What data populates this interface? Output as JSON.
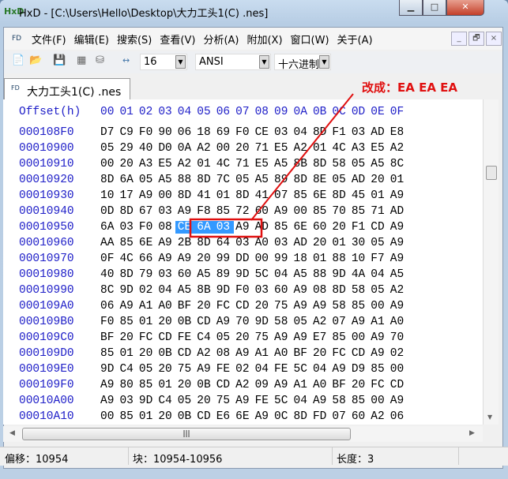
{
  "window": {
    "title": "HxD - [C:\\Users\\Hello\\Desktop\\大力工头1(C) .nes]",
    "app_icon": "HxD"
  },
  "menu": [
    "文件(F)",
    "编辑(E)",
    "搜索(S)",
    "查看(V)",
    "分析(A)",
    "附加(X)",
    "窗口(W)",
    "关于(A)"
  ],
  "toolbar": {
    "bytes_per_row": "16",
    "charset": "ANSI",
    "display": "十六进制"
  },
  "tab": {
    "label": "大力工头1(C) .nes"
  },
  "annotation": {
    "text": "改成：EA  EA  EA",
    "color": "#e01010"
  },
  "hex": {
    "header_offset": "Offset(h)",
    "header_cols": [
      "00",
      "01",
      "02",
      "03",
      "04",
      "05",
      "06",
      "07",
      "08",
      "09",
      "0A",
      "0B",
      "0C",
      "0D",
      "0E",
      "0F"
    ],
    "selected": {
      "row": "00010950",
      "start": 4,
      "end": 6
    },
    "rows": [
      {
        "offset": "000108F0",
        "bytes": [
          "D7",
          "C9",
          "F0",
          "90",
          "06",
          "18",
          "69",
          "F0",
          "CE",
          "03",
          "04",
          "8D",
          "F1",
          "03",
          "AD",
          "E8"
        ]
      },
      {
        "offset": "00010900",
        "bytes": [
          "05",
          "29",
          "40",
          "D0",
          "0A",
          "A2",
          "00",
          "20",
          "71",
          "E5",
          "A2",
          "01",
          "4C",
          "A3",
          "E5",
          "A2"
        ]
      },
      {
        "offset": "00010910",
        "bytes": [
          "00",
          "20",
          "A3",
          "E5",
          "A2",
          "01",
          "4C",
          "71",
          "E5",
          "A5",
          "8B",
          "8D",
          "58",
          "05",
          "A5",
          "8C"
        ]
      },
      {
        "offset": "00010920",
        "bytes": [
          "8D",
          "6A",
          "05",
          "A5",
          "88",
          "8D",
          "7C",
          "05",
          "A5",
          "89",
          "8D",
          "8E",
          "05",
          "AD",
          "20",
          "01"
        ]
      },
      {
        "offset": "00010930",
        "bytes": [
          "10",
          "17",
          "A9",
          "00",
          "8D",
          "41",
          "01",
          "8D",
          "41",
          "07",
          "85",
          "6E",
          "8D",
          "45",
          "01",
          "A9"
        ]
      },
      {
        "offset": "00010940",
        "bytes": [
          "0D",
          "8D",
          "67",
          "03",
          "A9",
          "F8",
          "85",
          "72",
          "60",
          "A9",
          "00",
          "85",
          "70",
          "85",
          "71",
          "AD"
        ]
      },
      {
        "offset": "00010950",
        "bytes": [
          "6A",
          "03",
          "F0",
          "08",
          "CE",
          "6A",
          "03",
          "A9",
          "AD",
          "85",
          "6E",
          "60",
          "20",
          "F1",
          "CD",
          "A9"
        ]
      },
      {
        "offset": "00010960",
        "bytes": [
          "AA",
          "85",
          "6E",
          "A9",
          "2B",
          "8D",
          "64",
          "03",
          "A0",
          "03",
          "AD",
          "20",
          "01",
          "30",
          "05",
          "A9"
        ]
      },
      {
        "offset": "00010970",
        "bytes": [
          "0F",
          "4C",
          "66",
          "A9",
          "A9",
          "20",
          "99",
          "DD",
          "00",
          "99",
          "18",
          "01",
          "88",
          "10",
          "F7",
          "A9"
        ]
      },
      {
        "offset": "00010980",
        "bytes": [
          "40",
          "8D",
          "79",
          "03",
          "60",
          "A5",
          "89",
          "9D",
          "5C",
          "04",
          "A5",
          "88",
          "9D",
          "4A",
          "04",
          "A5"
        ]
      },
      {
        "offset": "00010990",
        "bytes": [
          "8C",
          "9D",
          "02",
          "04",
          "A5",
          "8B",
          "9D",
          "F0",
          "03",
          "60",
          "A9",
          "08",
          "8D",
          "58",
          "05",
          "A2"
        ]
      },
      {
        "offset": "000109A0",
        "bytes": [
          "06",
          "A9",
          "A1",
          "A0",
          "BF",
          "20",
          "FC",
          "CD",
          "20",
          "75",
          "A9",
          "A9",
          "58",
          "85",
          "00",
          "A9"
        ]
      },
      {
        "offset": "000109B0",
        "bytes": [
          "F0",
          "85",
          "01",
          "20",
          "0B",
          "CD",
          "A9",
          "70",
          "9D",
          "58",
          "05",
          "A2",
          "07",
          "A9",
          "A1",
          "A0"
        ]
      },
      {
        "offset": "000109C0",
        "bytes": [
          "BF",
          "20",
          "FC",
          "CD",
          "FE",
          "C4",
          "05",
          "20",
          "75",
          "A9",
          "A9",
          "E7",
          "85",
          "00",
          "A9",
          "70"
        ]
      },
      {
        "offset": "000109D0",
        "bytes": [
          "85",
          "01",
          "20",
          "0B",
          "CD",
          "A2",
          "08",
          "A9",
          "A1",
          "A0",
          "BF",
          "20",
          "FC",
          "CD",
          "A9",
          "02"
        ]
      },
      {
        "offset": "000109E0",
        "bytes": [
          "9D",
          "C4",
          "05",
          "20",
          "75",
          "A9",
          "FE",
          "02",
          "04",
          "FE",
          "5C",
          "04",
          "A9",
          "D9",
          "85",
          "00"
        ]
      },
      {
        "offset": "000109F0",
        "bytes": [
          "A9",
          "80",
          "85",
          "01",
          "20",
          "0B",
          "CD",
          "A2",
          "09",
          "A9",
          "A1",
          "A0",
          "BF",
          "20",
          "FC",
          "CD"
        ]
      },
      {
        "offset": "00010A00",
        "bytes": [
          "A9",
          "03",
          "9D",
          "C4",
          "05",
          "20",
          "75",
          "A9",
          "FE",
          "5C",
          "04",
          "A9",
          "58",
          "85",
          "00",
          "A9"
        ]
      },
      {
        "offset": "00010A10",
        "bytes": [
          "00",
          "85",
          "01",
          "20",
          "0B",
          "CD",
          "E6",
          "6E",
          "A9",
          "0C",
          "8D",
          "FD",
          "07",
          "60",
          "A2",
          "06"
        ]
      }
    ]
  },
  "status": {
    "offset": "偏移：10954",
    "block": "块：10954-10956",
    "length": "长度：3"
  }
}
